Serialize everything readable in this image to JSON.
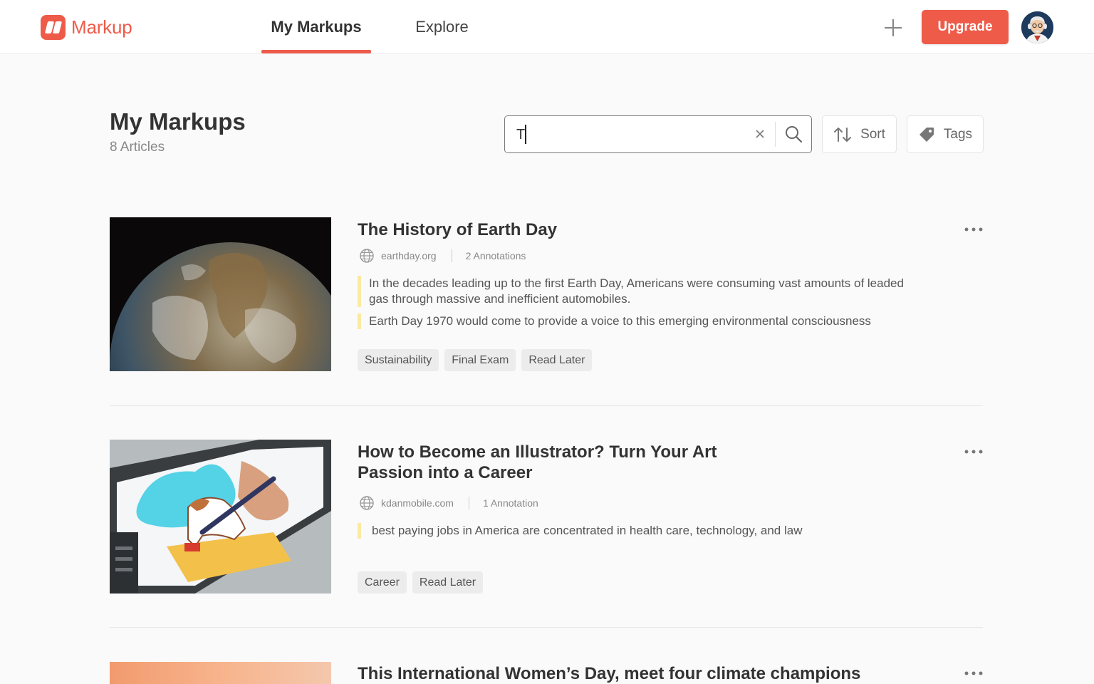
{
  "app": {
    "name": "Markup"
  },
  "nav": {
    "tabs": [
      {
        "label": "My Markups",
        "active": true
      },
      {
        "label": "Explore",
        "active": false
      }
    ],
    "add_icon": "plus-icon",
    "upgrade_label": "Upgrade",
    "avatar_icon": "user-avatar"
  },
  "header": {
    "title": "My Markups",
    "count": "8 Articles"
  },
  "search": {
    "value": "T",
    "placeholder": ""
  },
  "toolbar": {
    "sort_label": "Sort",
    "tags_label": "Tags"
  },
  "articles": [
    {
      "title": "The History of Earth Day",
      "domain": "earthday.org",
      "annotations": "2 Annotations",
      "highlights": [
        "In the decades leading up to the first Earth Day, Americans were consuming vast amounts of leaded gas through massive and inefficient automobiles.",
        "Earth Day 1970 would come to provide a voice to this emerging environmental consciousness"
      ],
      "tags": [
        "Sustainability",
        "Final Exam",
        "Read Later"
      ]
    },
    {
      "title": "How to Become an Illustrator? Turn Your Art Passion into a Career",
      "domain": "kdanmobile.com",
      "annotations": "1 Annotation",
      "highlights": [
        "best paying jobs in America are concentrated in health care, technology, and law"
      ],
      "tags": [
        "Career",
        "Read Later"
      ]
    },
    {
      "title": "This International Women’s Day, meet four climate champions"
    }
  ],
  "colors": {
    "accent": "#ee5b49",
    "highlight": "#fbe9a3",
    "tag_bg": "#ececec"
  }
}
